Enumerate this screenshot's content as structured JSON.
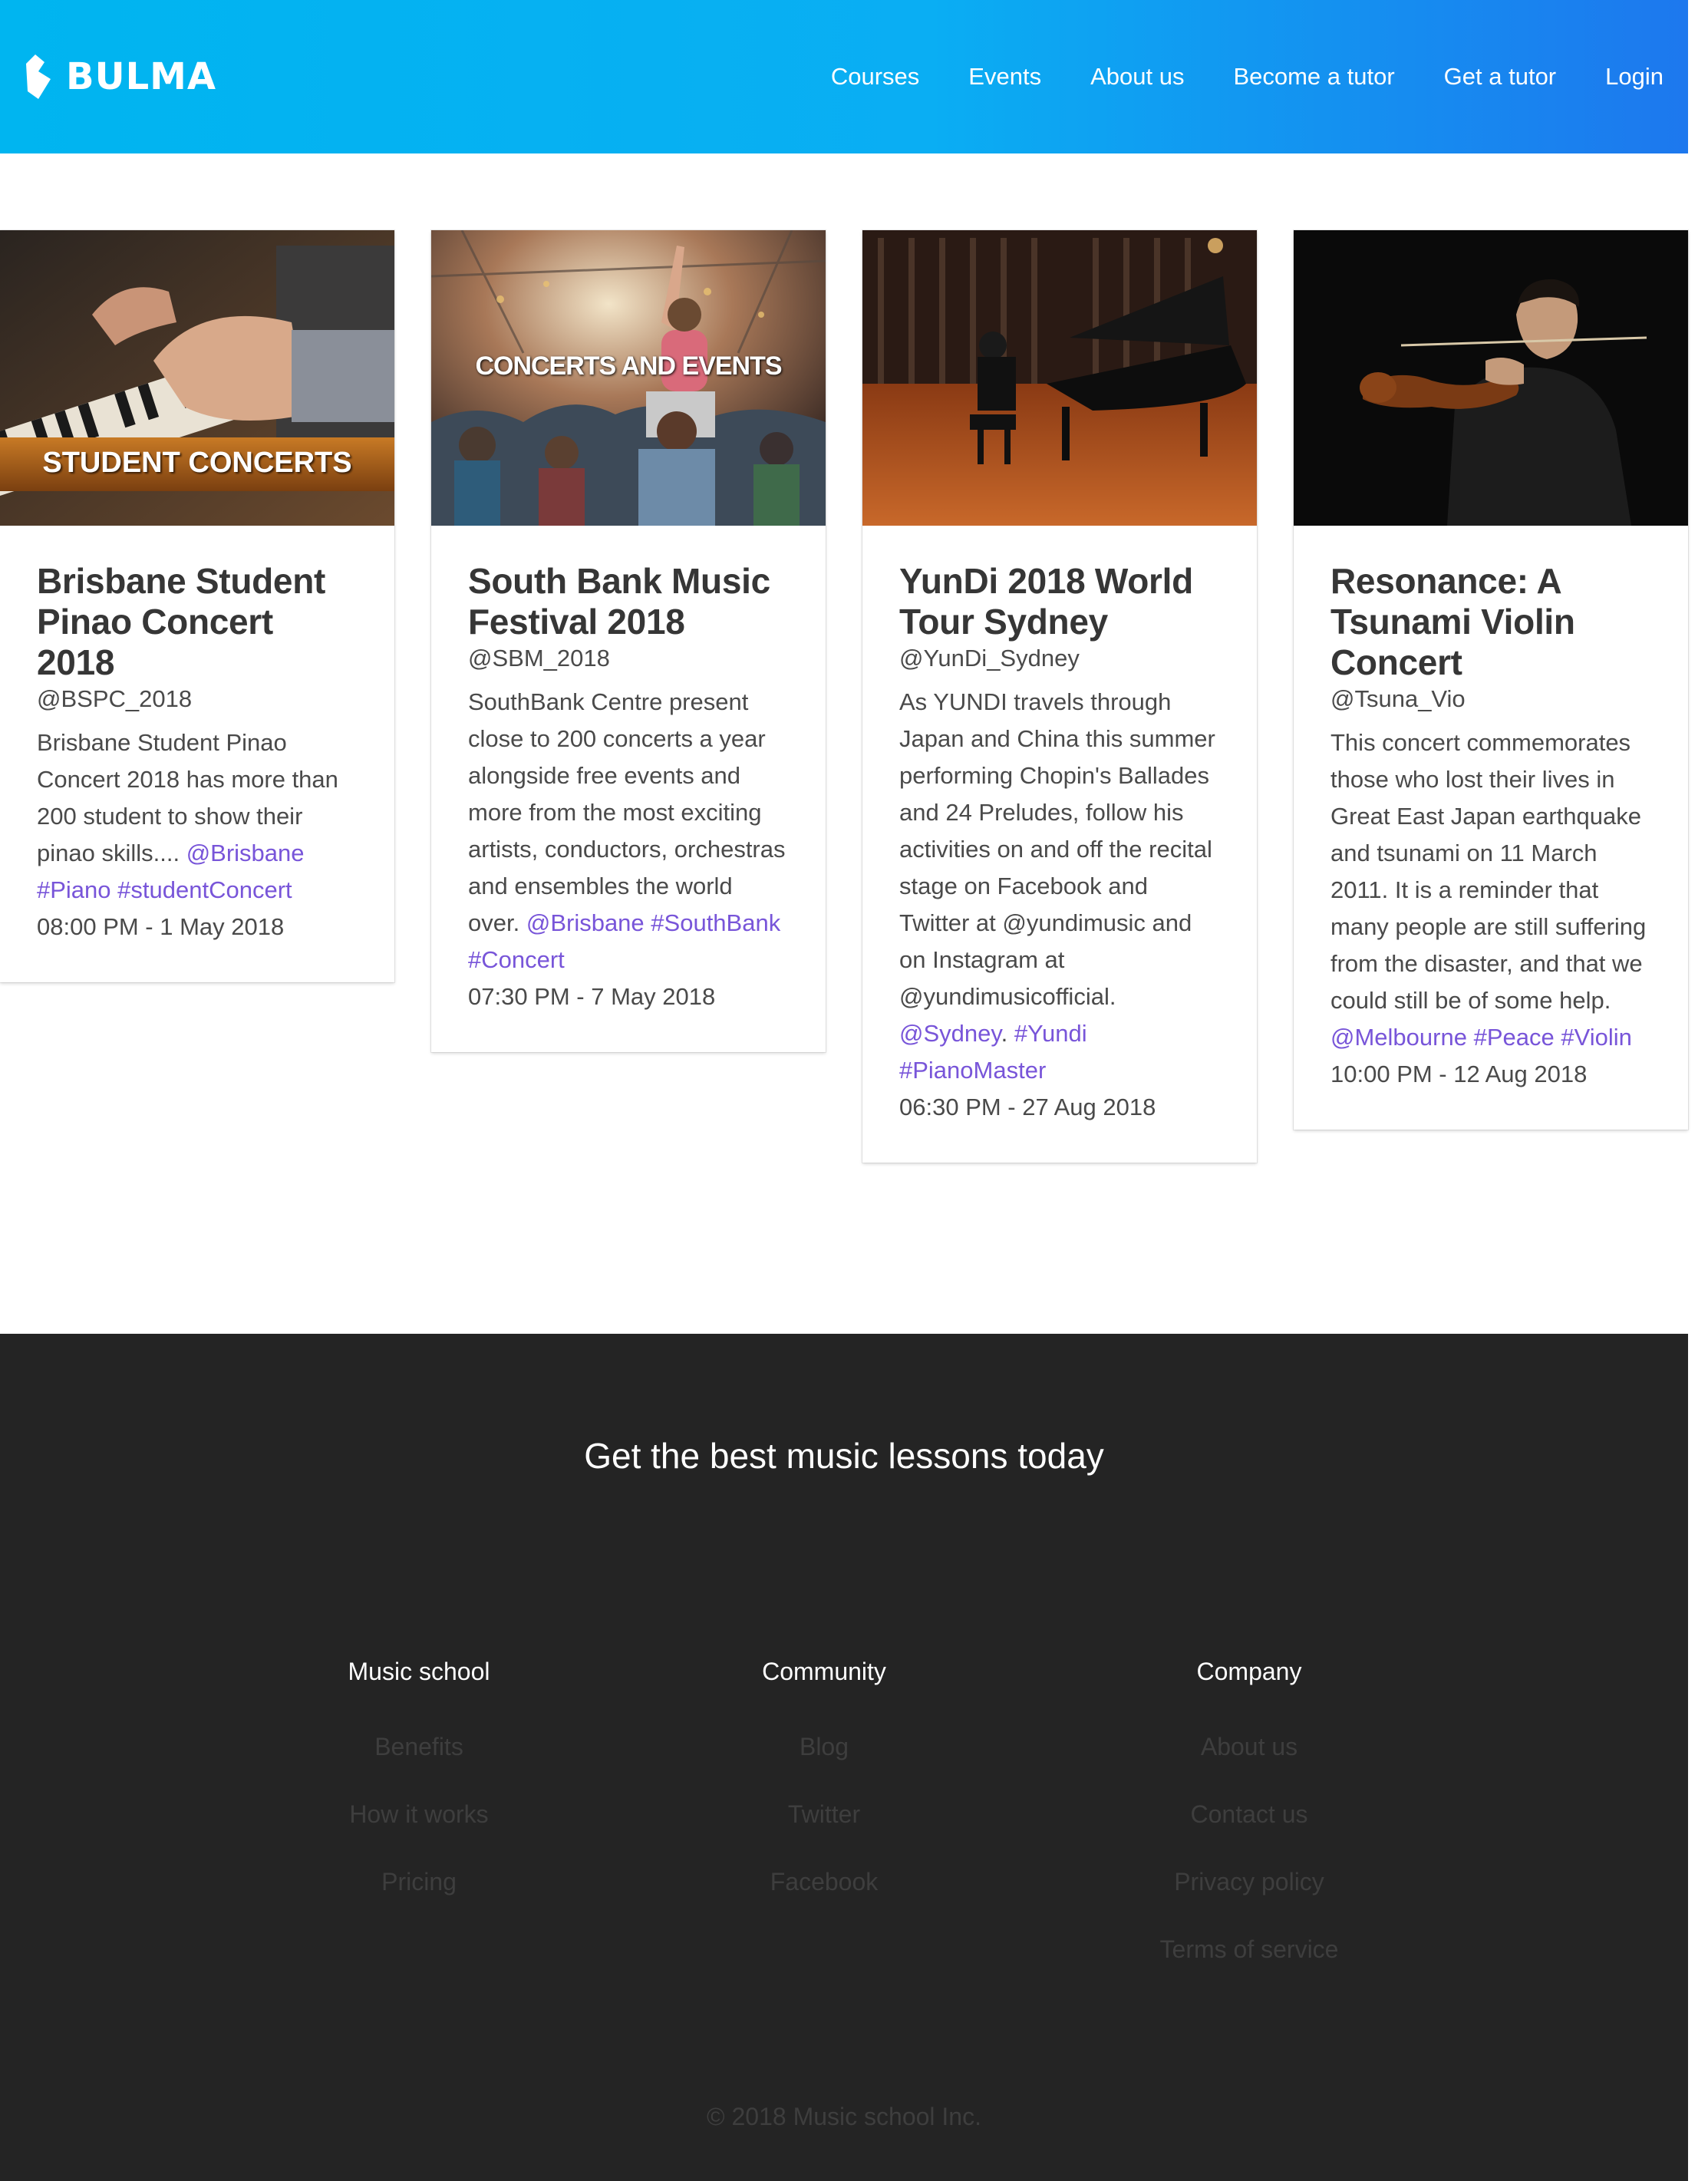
{
  "navbar": {
    "brand": "BULMA",
    "links": [
      "Courses",
      "Events",
      "About us",
      "Become a tutor",
      "Get a tutor",
      "Login"
    ]
  },
  "cards": [
    {
      "banner": "STUDENT CONCERTS",
      "title": "Brisbane Student Pinao Concert 2018",
      "handle": "@BSPC_2018",
      "description": "Brisbane Student Pinao Concert 2018 has more than 200 student to show their pinao skills....",
      "tags": [
        "@Brisbane",
        "#Piano",
        "#studentConcert"
      ],
      "time": "08:00 PM - 1 May 2018"
    },
    {
      "banner": "CONCERTS AND EVENTS",
      "title": "South Bank Music Festival 2018",
      "handle": "@SBM_2018",
      "description": "SouthBank Centre present close to 200 concerts a year alongside free events and more from the most exciting artists, conductors, orchestras and ensembles the world over.",
      "tags": [
        "@Brisbane",
        "#SouthBank",
        "#Concert"
      ],
      "time": "07:30 PM - 7 May 2018"
    },
    {
      "title": "YunDi 2018 World Tour Sydney",
      "handle": "@YunDi_Sydney",
      "description": "As YUNDI travels through Japan and China this summer performing Chopin's Ballades and 24 Preludes, follow his activities on and off the recital stage on Facebook and Twitter at @yundimusic and on Instagram at @yundimusicofficial.",
      "tags": [
        "@Sydney",
        "#Yundi",
        "#PianoMaster"
      ],
      "time": "06:30 PM - 27 Aug 2018"
    },
    {
      "title": "Resonance: A Tsunami Violin Concert",
      "handle": "@Tsuna_Vio",
      "description": "This concert commemorates those who lost their lives in Great East Japan earthquake and tsunami on 11 March 2011. It is a reminder that many people are still suffering from the disaster, and that we could still be of some help.",
      "tags": [
        "@Melbourne",
        "#Peace",
        "#Violin"
      ],
      "time": "10:00 PM - 12 Aug 2018"
    }
  ],
  "footer": {
    "headline": "Get the best music lessons today",
    "columns": [
      {
        "title": "Music school",
        "links": [
          "Benefits",
          "How it works",
          "Pricing"
        ]
      },
      {
        "title": "Community",
        "links": [
          "Blog",
          "Twitter",
          "Facebook"
        ]
      },
      {
        "title": "Company",
        "links": [
          "About us",
          "Contact us",
          "Privacy policy",
          "Terms of service"
        ]
      }
    ],
    "copyright": "© 2018 Music school Inc."
  },
  "colors": {
    "navbar_gradient_start": "#00b5f0",
    "navbar_gradient_end": "#1d78ee",
    "tag_link": "#7855d9",
    "footer_bg": "#242424"
  }
}
